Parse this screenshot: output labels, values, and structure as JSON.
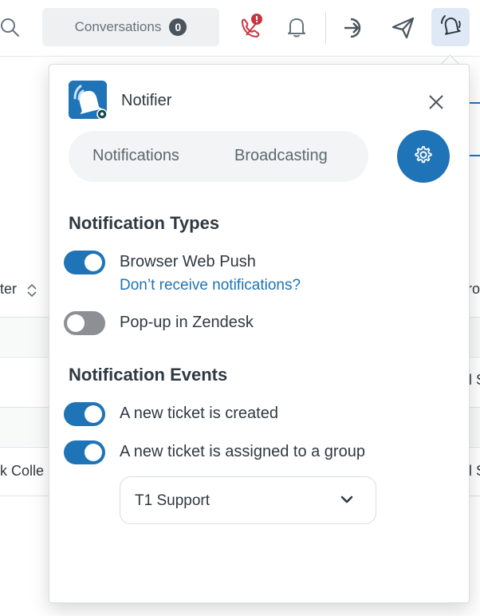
{
  "topbar": {
    "conversations_label": "Conversations",
    "conversations_count": "0"
  },
  "background": {
    "column_header": "ter",
    "row_text": "k Colle",
    "right_header_fragment": "ro",
    "right_cell_1": "l S",
    "right_cell_2": "l S"
  },
  "notifier": {
    "app_title": "Notifier",
    "tabs": [
      {
        "label": "Notifications"
      },
      {
        "label": "Broadcasting"
      }
    ],
    "notification_types": {
      "title": "Notification Types",
      "options": [
        {
          "label": "Browser Web Push",
          "enabled": true
        },
        {
          "label": "Pop-up in Zendesk",
          "enabled": false
        }
      ],
      "help_link": "Don’t receive notifications?"
    },
    "notification_events": {
      "title": "Notification Events",
      "options": [
        {
          "label": "A new ticket is created",
          "enabled": true
        },
        {
          "label": "A new ticket is assigned to a group",
          "enabled": true
        }
      ],
      "group_select_value": "T1 Support"
    }
  },
  "colors": {
    "accent": "#1f73b7",
    "toggle_off": "#8c9094",
    "alert_badge": "#cc3340",
    "phone_icon": "#cc3340"
  }
}
